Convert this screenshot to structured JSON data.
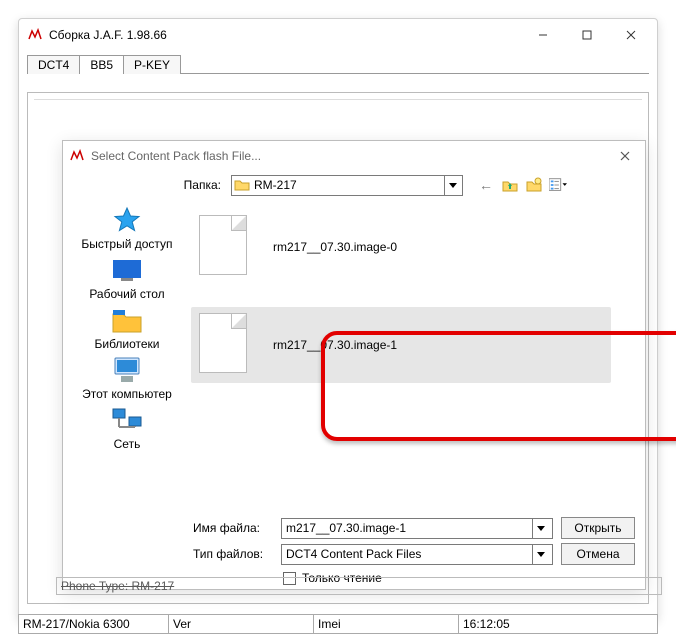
{
  "window": {
    "title": "Сборка J.A.F.  1.98.66"
  },
  "tabs": [
    "DCT4",
    "BB5",
    "P-KEY"
  ],
  "active_tab": "BB5",
  "dialog": {
    "title": "Select Content Pack flash File...",
    "folder_label": "Папка:",
    "folder_name": "RM-217",
    "places": [
      "Быстрый доступ",
      "Рабочий стол",
      "Библиотеки",
      "Этот компьютер",
      "Сеть"
    ],
    "files": [
      {
        "name": "rm217__07.30.image-0",
        "selected": false
      },
      {
        "name": "rm217__07.30.image-1",
        "selected": true
      }
    ],
    "filename_label": "Имя файла:",
    "filename_value": "m217__07.30.image-1",
    "filetype_label": "Тип файлов:",
    "filetype_value": "DCT4 Content Pack Files",
    "readonly_label": "Только чтение",
    "open_btn": "Открыть",
    "cancel_btn": "Отмена"
  },
  "phone_type_row": "Phone Type: RM-217",
  "status": {
    "c0": "RM-217/Nokia 6300",
    "c1": "Ver",
    "c2": "Imei",
    "c3": "16:12:05"
  }
}
